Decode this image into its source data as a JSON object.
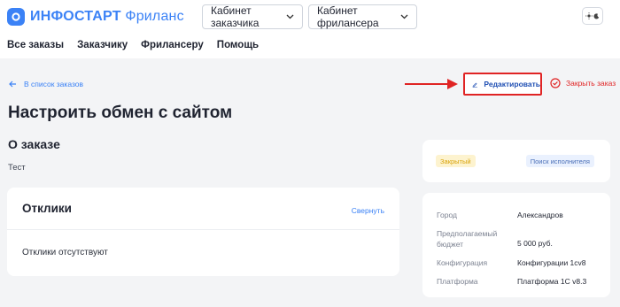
{
  "brand": {
    "name_bold": "ИНФОСТАРТ",
    "name_light": "Фриланс",
    "color": "#3b82f6"
  },
  "header": {
    "dropdowns": [
      {
        "label": "Кабинет заказчика",
        "icon": "chevron-down-icon"
      },
      {
        "label": "Кабинет фрилансера",
        "icon": "chevron-down-icon"
      }
    ],
    "theme_toggle_icon": "sun-moon-icon"
  },
  "nav": {
    "items": [
      {
        "label": "Все заказы"
      },
      {
        "label": "Заказчику"
      },
      {
        "label": "Фрилансеру"
      },
      {
        "label": "Помощь"
      }
    ]
  },
  "actions": {
    "back_label": "В список заказов",
    "edit_label": "Редактировать",
    "close_label": "Закрыть заказ",
    "annotation_color": "#e02424"
  },
  "order": {
    "title": "Настроить обмен с сайтом",
    "about_title": "О заказе",
    "about_text": "Тест"
  },
  "responses": {
    "title": "Отклики",
    "collapse_label": "Свернуть",
    "empty_text": "Отклики отсутствуют"
  },
  "status": {
    "state_label": "Закрытый",
    "search_label": "Поиск исполнителя"
  },
  "details": [
    {
      "label": "Город",
      "value": "Александров"
    },
    {
      "label": "Предполагаемый бюджет",
      "value": "5 000 руб."
    },
    {
      "label": "Конфигурация",
      "value": "Конфигурации 1cv8"
    },
    {
      "label": "Платформа",
      "value": "Платформа 1С v8.3"
    }
  ]
}
